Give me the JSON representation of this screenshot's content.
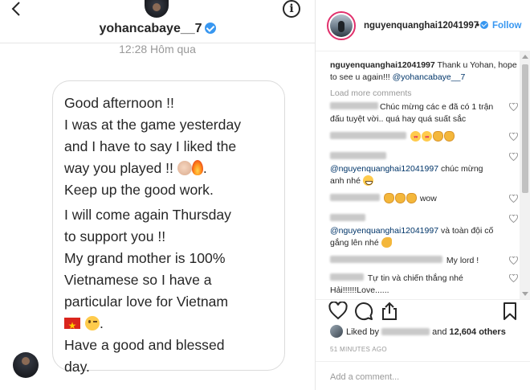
{
  "dm": {
    "username": "yohancabaye__7",
    "timestamp": "12:28 Hôm qua",
    "message_lines": [
      "Good afternoon !!",
      "I was at the game yesterday",
      "and I have to say I liked the",
      "way you played !! ",
      "Keep up the good work.",
      "I will come again Thursday",
      "to support you !!",
      "My grand mother is 100%",
      "Vietnamese so I have a",
      "particular love for Vietnam",
      "Have a good and blessed",
      "day."
    ],
    "line4_suffix": ".",
    "line13_suffix": "."
  },
  "post": {
    "username": "nguyenquanghai12041997",
    "dot": "•",
    "follow_label": "Follow",
    "caption_user": "nguyenquanghai12041997",
    "caption_text": " Thank u Yohan, hope to see u again!!! ",
    "caption_mention": "@yohancabaye__7",
    "load_more": "Load more comments",
    "comments": [
      {
        "text": "Chúc mừng các e đã có 1 trận đấu tuyệt vời.. quá hay quá suất sắc"
      },
      {
        "text": ""
      },
      {
        "mention": "@nguyenquanghai12041997",
        "text": " chúc mừng anh nhé "
      },
      {
        "text": " wow"
      },
      {
        "mention": "@nguyenquanghai12041997",
        "text": " và toàn đội cố gắng lên nhé "
      },
      {
        "text": "My lord !"
      },
      {
        "text": "Tự tin và chiến thắng nhé Hải!!!!!!Love......"
      }
    ],
    "likes_prefix": "Liked by ",
    "likes_middle": " and ",
    "likes_count": "12,604 others",
    "time_ago": "51 MINUTES AGO",
    "add_comment_placeholder": "Add a comment..."
  },
  "icons": {
    "back": "chevron-left-icon",
    "info": "info-icon",
    "verified": "verified-badge-icon",
    "heart": "heart-icon",
    "comment": "comment-icon",
    "share": "share-icon",
    "bookmark": "bookmark-icon"
  },
  "colors": {
    "accent_blue": "#3897f0",
    "mention_blue": "#003569",
    "text_primary": "#262626",
    "text_muted": "#999999",
    "border": "#dbdbdb"
  }
}
